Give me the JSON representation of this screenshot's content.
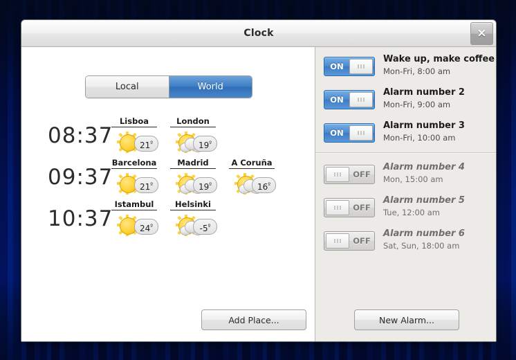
{
  "window": {
    "title": "Clock",
    "close_label": "×"
  },
  "left_panel": {
    "tabs": [
      {
        "label": "Local",
        "selected": false
      },
      {
        "label": "World",
        "selected": true
      }
    ],
    "clock_rows": [
      {
        "time": "08:37",
        "places": [
          {
            "name": "Lisboa",
            "temp": "21",
            "degree": "º",
            "icon": "sunny-icon"
          },
          {
            "name": "London",
            "temp": "19",
            "degree": "º",
            "icon": "partly-cloudy-icon"
          }
        ]
      },
      {
        "time": "09:37",
        "places": [
          {
            "name": "Barcelona",
            "temp": "21",
            "degree": "º",
            "icon": "sunny-icon"
          },
          {
            "name": "Madrid",
            "temp": "19",
            "degree": "º",
            "icon": "partly-cloudy-icon"
          },
          {
            "name": "A Coruña",
            "temp": "16",
            "degree": "º",
            "icon": "partly-cloudy-icon"
          }
        ]
      },
      {
        "time": "10:37",
        "places": [
          {
            "name": "Istambul",
            "temp": "24",
            "degree": "º",
            "icon": "sunny-icon"
          },
          {
            "name": "Helsinki",
            "temp": "-5",
            "degree": "º",
            "icon": "partly-cloudy-icon"
          }
        ]
      }
    ],
    "add_place_label": "Add Place..."
  },
  "right_panel": {
    "alarms_enabled": [
      {
        "title": "Wake up, make coffee",
        "schedule": "Mon-Fri, 8:00 am",
        "toggle_label": "ON",
        "enabled": true
      },
      {
        "title": "Alarm number 2",
        "schedule": "Mon-Fri, 9:00 am",
        "toggle_label": "ON",
        "enabled": true
      },
      {
        "title": "Alarm number 3",
        "schedule": "Mon-Fri, 10:00 am",
        "toggle_label": "ON",
        "enabled": true
      }
    ],
    "alarms_disabled": [
      {
        "title": "Alarm number 4",
        "schedule": "Mon, 15:00 am",
        "toggle_label": "OFF",
        "enabled": false
      },
      {
        "title": "Alarm number 5",
        "schedule": "Tue, 12:00 am",
        "toggle_label": "OFF",
        "enabled": false
      },
      {
        "title": "Alarm number 6",
        "schedule": "Sat, Sun, 18:00 am",
        "toggle_label": "OFF",
        "enabled": false
      }
    ],
    "new_alarm_label": "New Alarm..."
  },
  "colors": {
    "accent_blue": "#3d7cc4",
    "panel_gray": "#edebe8",
    "desktop_blue": "#0d2a5e"
  }
}
